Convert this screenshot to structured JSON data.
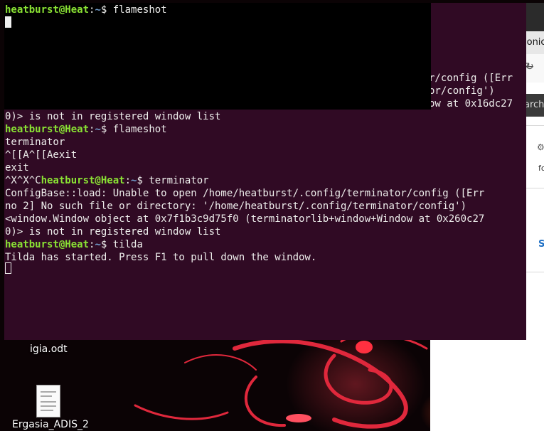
{
  "browser": {
    "tab_text": "ionic",
    "search_text": "arch",
    "side_text": "fo",
    "link_text": "S",
    "minimize_icon": "minimize-icon",
    "maximize_icon": "maximize-icon",
    "close_icon": "close-icon",
    "back_icon": "arrow-left-icon",
    "refresh_icon": "refresh-icon",
    "settings_icon": "settings-icon"
  },
  "tilda": {
    "prompt_user": "heatburst@Heat",
    "prompt_path": "~",
    "command": "flameshot"
  },
  "terminator": {
    "top_lines": [
      "r/config ([Err",
      "or/config')",
      "ow at 0x16dc27"
    ],
    "lines": [
      {
        "text": "0)> is not in registered window list"
      },
      {
        "prompt": true,
        "user": "heatburst@Heat",
        "path": "~",
        "cmd": "flameshot"
      },
      {
        "text": "terminator"
      },
      {
        "text": "^[[A^[[Aexit"
      },
      {
        "text": "exit"
      },
      {
        "prefix": "^X^X^C",
        "prompt": true,
        "user": "heatburst@Heat",
        "path": "~",
        "cmd": "terminator"
      },
      {
        "text": "ConfigBase::load: Unable to open /home/heatburst/.config/terminator/config ([Err"
      },
      {
        "text": "no 2] No such file or directory: '/home/heatburst/.config/terminator/config')"
      },
      {
        "text": "<window.Window object at 0x7f1b3c9d75f0 (terminatorlib+window+Window at 0x260c27"
      },
      {
        "text": "0)> is not in registered window list"
      },
      {
        "prompt": true,
        "user": "heatburst@Heat",
        "path": "~",
        "cmd": "tilda"
      },
      {
        "text": "Tilda has started. Press F1 to pull down the window."
      }
    ]
  },
  "desktop": {
    "icon1_label": "igia.odt",
    "icon2_label": "Ergasia_ADIS_2"
  },
  "colors": {
    "terminal_bg": "#300a24",
    "prompt_user": "#8ae234",
    "prompt_path": "#729fcf",
    "tilda_bg": "#000000"
  }
}
